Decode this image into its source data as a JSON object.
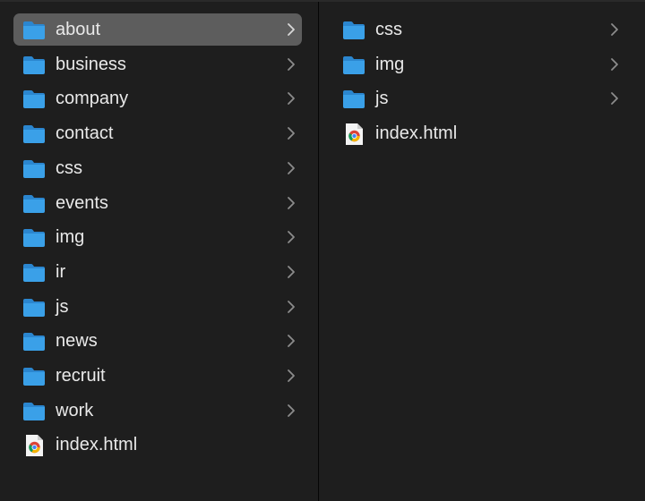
{
  "window": {
    "title": ""
  },
  "colors": {
    "folder_body": "#3aa0e8",
    "folder_tab": "#2b86cf",
    "selection": "#5d5d5d",
    "background": "#1e1e1e",
    "text": "#e9e9e9",
    "chevron": "#8c8c8c"
  },
  "column1": {
    "selected_index": 0,
    "items": [
      {
        "label": "about",
        "kind": "folder",
        "icon": "folder-icon"
      },
      {
        "label": "business",
        "kind": "folder",
        "icon": "folder-icon"
      },
      {
        "label": "company",
        "kind": "folder",
        "icon": "folder-icon"
      },
      {
        "label": "contact",
        "kind": "folder",
        "icon": "folder-icon"
      },
      {
        "label": "css",
        "kind": "folder",
        "icon": "folder-icon"
      },
      {
        "label": "events",
        "kind": "folder",
        "icon": "folder-icon"
      },
      {
        "label": "img",
        "kind": "folder",
        "icon": "folder-icon"
      },
      {
        "label": "ir",
        "kind": "folder",
        "icon": "folder-icon"
      },
      {
        "label": "js",
        "kind": "folder",
        "icon": "folder-icon"
      },
      {
        "label": "news",
        "kind": "folder",
        "icon": "folder-icon"
      },
      {
        "label": "recruit",
        "kind": "folder",
        "icon": "folder-icon"
      },
      {
        "label": "work",
        "kind": "folder",
        "icon": "folder-icon"
      },
      {
        "label": "index.html",
        "kind": "file",
        "icon": "chrome-html-file-icon"
      }
    ]
  },
  "column2": {
    "items": [
      {
        "label": "css",
        "kind": "folder",
        "icon": "folder-icon"
      },
      {
        "label": "img",
        "kind": "folder",
        "icon": "folder-icon"
      },
      {
        "label": "js",
        "kind": "folder",
        "icon": "folder-icon"
      },
      {
        "label": "index.html",
        "kind": "file",
        "icon": "chrome-html-file-icon"
      }
    ]
  }
}
